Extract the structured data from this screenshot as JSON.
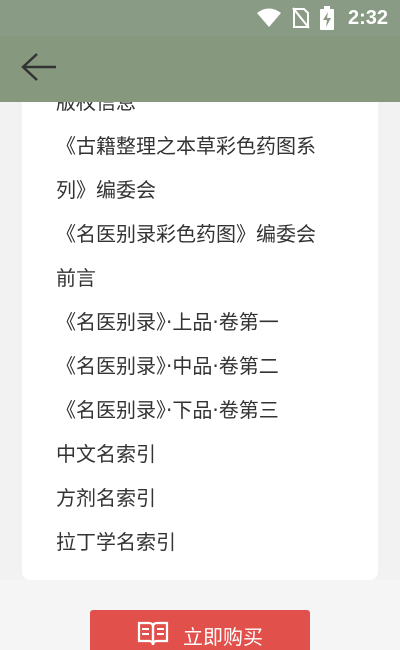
{
  "status_bar": {
    "time": "2:32",
    "icons": [
      "wifi-icon",
      "no-sim-icon",
      "battery-charging-icon"
    ]
  },
  "app_bar": {
    "back_icon": "arrow-left-icon"
  },
  "toc": {
    "items": [
      "版权信息",
      "《古籍整理之本草彩色药图系",
      "列》编委会",
      "《名医别录彩色药图》编委会",
      "前言",
      "《名医别录》·上品·卷第一",
      "《名医别录》·中品·卷第二",
      "《名医别录》·下品·卷第三",
      "中文名索引",
      "方剂名索引",
      "拉丁学名索引"
    ]
  },
  "buy_button": {
    "label": "立即购买",
    "icon": "open-book-icon"
  },
  "colors": {
    "status_bar": "#8a9b85",
    "app_bar": "#86997f",
    "buy_button": "#e2504b",
    "text": "#333333"
  }
}
